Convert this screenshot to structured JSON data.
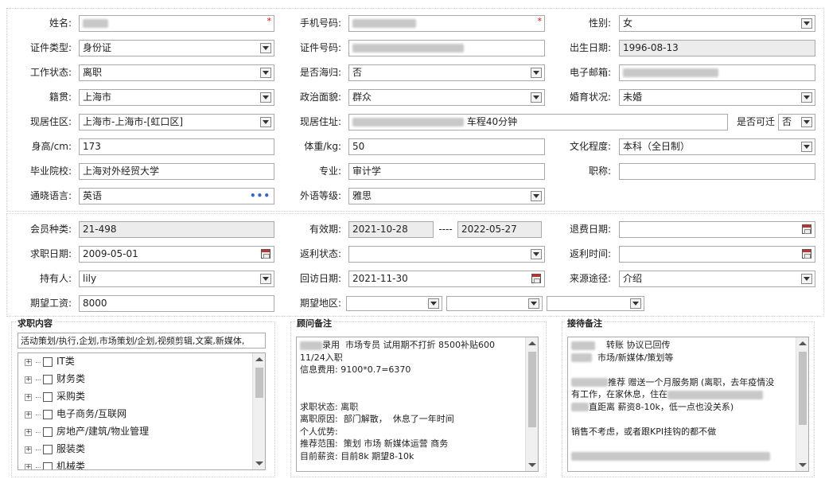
{
  "row1": {
    "name_label": "姓名:",
    "phone_label": "手机号码:",
    "gender_label": "性别:",
    "gender": "女"
  },
  "row2": {
    "idtype_label": "证件类型:",
    "idtype": "身份证",
    "idno_label": "证件号码:",
    "birth_label": "出生日期:",
    "birth": "1996-08-13"
  },
  "row3": {
    "work_label": "工作状态:",
    "work": "离职",
    "overseas_label": "是否海归:",
    "overseas": "否",
    "email_label": "电子邮箱:"
  },
  "row4": {
    "origin_label": "籍贯:",
    "origin": "上海市",
    "political_label": "政治面貌:",
    "political": "群众",
    "marital_label": "婚育状况:",
    "marital": "未婚"
  },
  "row5": {
    "region_label": "现居住区:",
    "region": "上海市-上海市-[虹口区]",
    "addr_label": "现居住址:",
    "addr_tail": "车程40分钟",
    "relocate_label": "是否可迁",
    "relocate": "否"
  },
  "row6": {
    "height_label": "身高/cm:",
    "height": "173",
    "weight_label": "体重/kg:",
    "weight": "50",
    "edu_label": "文化程度:",
    "edu": "本科（全日制）"
  },
  "row7": {
    "school_label": "毕业院校:",
    "school": "上海对外经贸大学",
    "major_label": "专业:",
    "major": "审计学",
    "title_label": "职称:"
  },
  "row8": {
    "lang_label": "通晓语言:",
    "lang": "英语",
    "lang_more": "•••",
    "level_label": "外语等级:",
    "level": "雅思"
  },
  "row9": {
    "member_label": "会员种类:",
    "member": "21-498",
    "valid_label": "有效期:",
    "valid_from": "2021-10-28",
    "valid_sep": "----",
    "valid_to": "2022-05-27",
    "refund_label": "退费日期:"
  },
  "row10": {
    "apply_label": "求职日期:",
    "apply": "2009-05-01",
    "rebate_label": "返利状态:",
    "rebatetime_label": "返利时间:"
  },
  "row11": {
    "holder_label": "持有人:",
    "holder": "lily",
    "visit_label": "回访日期:",
    "visit": "2021-11-30",
    "source_label": "来源途径:",
    "source": "介绍"
  },
  "row12": {
    "salary_label": "期望工资:",
    "salary": "8000",
    "area_label": "期望地区:"
  },
  "job": {
    "title": "求职内容",
    "content": "活动策划/执行,企划,市场策划/企划,视频剪辑,文案,新媒体,",
    "items": [
      "IT类",
      "财务类",
      "采购类",
      "电子商务/互联网",
      "房地产/建筑/物业管理",
      "服装类",
      "机械类"
    ]
  },
  "consult": {
    "title": "顾问备注",
    "line1": "录用  市场专员 试用期不打折 8500补贴600",
    "line2": "11/24入职",
    "line3": "信息费用: 9100*0.7=6370",
    "line4": "求职状态: 离职",
    "line5": "离职原因:  部门解散，  休息了一年时间",
    "line6": "个人优势:",
    "line7": "推荐范围:  策划 市场 新媒体运营 商务",
    "line8": "目前薪资: 目前8k 期望8-10k"
  },
  "reception": {
    "title": "接待备注",
    "line1": "转账  协议已回传",
    "line2": "市场/新媒体/策划等",
    "line3": "推荐 赠送一个月服务期 (离职，去年疫情没",
    "line4": "有工作，在家休息，住在",
    "line5": "直距离 薪资8-10k，低一点也没关系)",
    "line6": "销售不考虑，或者跟KPI挂钩的都不做"
  },
  "colors": {
    "border": "#a9a9a9",
    "readonly": "#ececec",
    "required": "#e00000"
  }
}
